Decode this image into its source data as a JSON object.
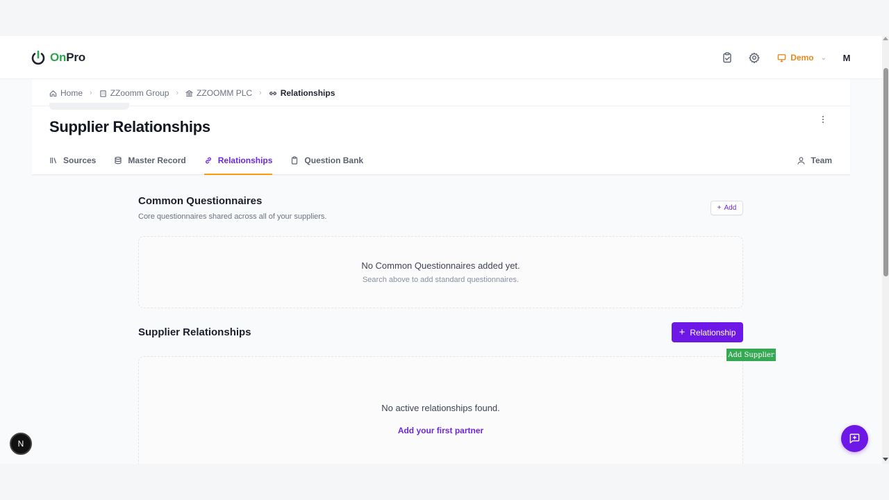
{
  "brand": {
    "name_part1": "On",
    "name_part2": "Pro",
    "accent": "#2ea44f"
  },
  "topnav": {
    "icons": [
      "clipboard-check-icon",
      "gear-icon",
      "monitor-icon"
    ],
    "workspace_label": "Demo",
    "avatar_initial": "M"
  },
  "breadcrumb": [
    {
      "label": "Home",
      "icon": "home-icon"
    },
    {
      "label": "ZZoomm Group",
      "icon": "building-icon"
    },
    {
      "label": "ZZOOMM PLC",
      "icon": "bank-icon"
    },
    {
      "label": "Relationships",
      "icon": "link-icon"
    }
  ],
  "page": {
    "title": "Supplier Relationships"
  },
  "tabs": [
    {
      "label": "Sources",
      "icon": "library-icon",
      "active": false
    },
    {
      "label": "Master Record",
      "icon": "database-icon",
      "active": false
    },
    {
      "label": "Relationships",
      "icon": "link-icon",
      "active": true
    },
    {
      "label": "Question Bank",
      "icon": "clipboard-icon",
      "active": false
    }
  ],
  "team_label": "Team",
  "common": {
    "title": "Common Questionnaires",
    "subtitle": "Core questionnaires shared across all of your suppliers.",
    "add_label": "Add",
    "empty_title": "No Common Questionnaires added yet.",
    "empty_sub": "Search above to add standard questionnaires."
  },
  "suppliers": {
    "title": "Supplier Relationships",
    "button_label": "Relationship",
    "tooltip": "Add Supplier",
    "empty_title": "No active relationships found.",
    "empty_link": "Add your first partner"
  },
  "fab_left_label": "N",
  "colors": {
    "primary": "#6d18e6",
    "active_tab_text": "#6d28d9",
    "active_tab_underline": "#f59e0b",
    "demo": "#e8891c"
  }
}
